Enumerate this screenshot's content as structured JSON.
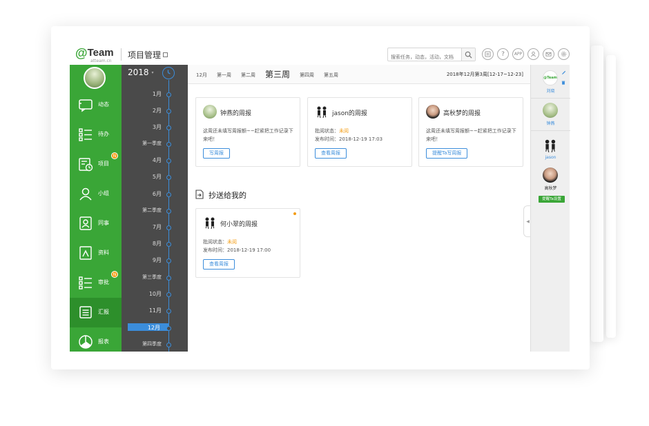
{
  "brand": {
    "logo_at": "@",
    "logo_text": "Team",
    "logo_sub": "atteam.cn",
    "accent": "#3aa637"
  },
  "header": {
    "title": "项目管理",
    "search_placeholder": "搜索任务，动态，活动，文档",
    "tools": [
      "news-icon",
      "help-icon",
      "APP",
      "user-icon",
      "mail-icon",
      "settings-icon"
    ],
    "app_label": "APP"
  },
  "sidebar": {
    "items": [
      {
        "label": "动态",
        "icon": "activity-icon",
        "badge": ""
      },
      {
        "label": "待办",
        "icon": "todo-icon",
        "badge": ""
      },
      {
        "label": "项目",
        "icon": "project-icon",
        "badge": "N"
      },
      {
        "label": "小组",
        "icon": "group-icon",
        "badge": ""
      },
      {
        "label": "同事",
        "icon": "colleague-icon",
        "badge": ""
      },
      {
        "label": "资料",
        "icon": "files-icon",
        "badge": ""
      },
      {
        "label": "审批",
        "icon": "approval-icon",
        "badge": "N"
      },
      {
        "label": "汇报",
        "icon": "report-icon",
        "badge": ""
      },
      {
        "label": "报表",
        "icon": "chart-icon",
        "badge": ""
      }
    ],
    "active": "汇报"
  },
  "timeline": {
    "year": "2018",
    "caret": "▾",
    "items": [
      "1月",
      "2月",
      "3月",
      "第一季度",
      "4月",
      "5月",
      "6月",
      "第二季度",
      "7月",
      "8月",
      "9月",
      "第三季度",
      "10月",
      "11月",
      "12月",
      "第四季度"
    ],
    "active": "12月"
  },
  "weekbar": {
    "items": [
      "12月",
      "第一周",
      "第二周",
      "第三周",
      "第四周",
      "第五周"
    ],
    "active": "第三周",
    "date_range": "2018年12月第3周[12-17~12-23]"
  },
  "reports": [
    {
      "title": "钟燕的周报",
      "desc": "这周还未填写周报额~~赶紧把工作记录下来吧！",
      "button": "写周报"
    },
    {
      "title": "jason的周报",
      "status_label": "批阅状态：",
      "status": "未阅",
      "time": "发布时间：2018-12-19 17:03",
      "button": "查看周报"
    },
    {
      "title": "高秋梦的周报",
      "desc": "这周还未填写周报额~~赶紧把工作记录下来吧！",
      "button": "提醒Ta写周报"
    }
  ],
  "cc_section": {
    "title": "抄送给我的",
    "card": {
      "title": "何小翠的周报",
      "status_label": "批阅状态：",
      "status": "未阅",
      "time": "发布时间：2018-12-19 17:00",
      "button": "查看周报"
    }
  },
  "right_panel": {
    "members": [
      {
        "name": "刘晓"
      },
      {
        "name": "钟燕"
      },
      {
        "name": "jason"
      },
      {
        "name": "高秋梦"
      }
    ],
    "remind_button": "提醒Ta设置",
    "team_logo": "@Team"
  }
}
